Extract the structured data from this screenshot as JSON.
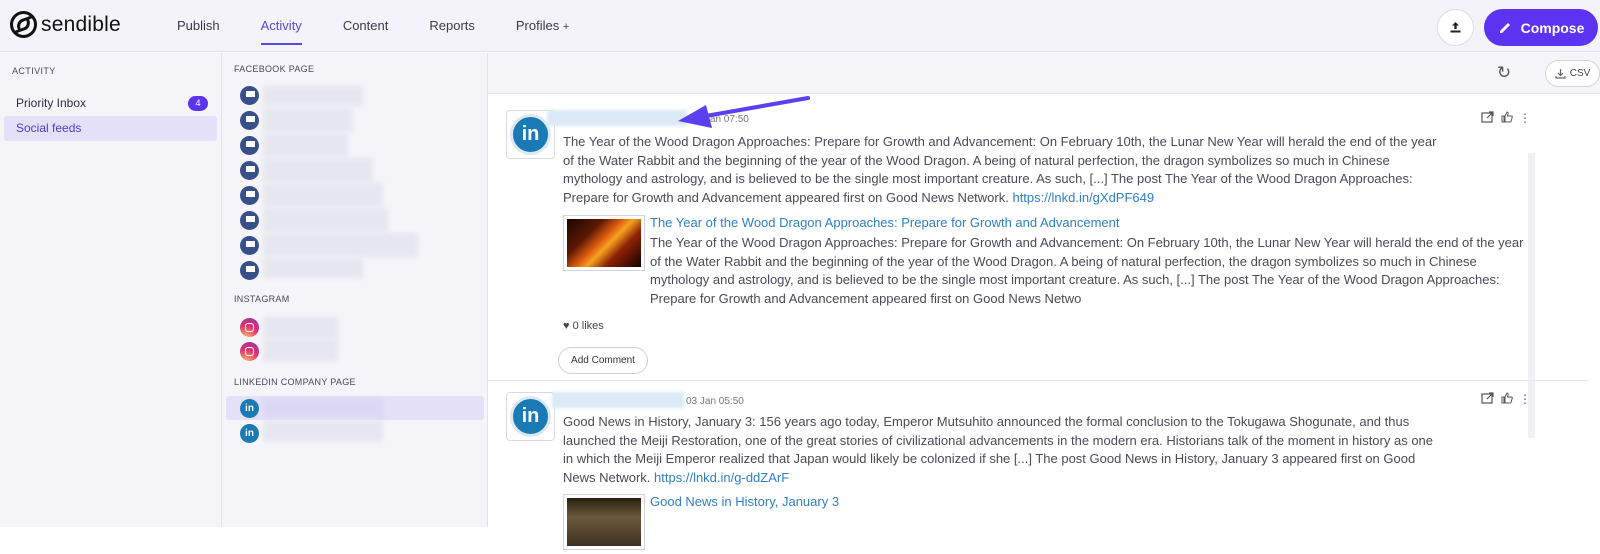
{
  "app": {
    "name": "sendible"
  },
  "nav": {
    "items": [
      {
        "label": "Publish"
      },
      {
        "label": "Activity"
      },
      {
        "label": "Content"
      },
      {
        "label": "Reports"
      },
      {
        "label": "Profiles",
        "suffix": "+"
      }
    ],
    "active": "Activity",
    "compose_label": "Compose"
  },
  "sidebar": {
    "heading": "ACTIVITY",
    "items": [
      {
        "label": "Priority Inbox",
        "badge": "4"
      },
      {
        "label": "Social feeds"
      }
    ]
  },
  "profiles": {
    "facebook_heading": "FACEBOOK PAGE",
    "instagram_heading": "INSTAGRAM",
    "linkedin_heading": "LINKEDIN COMPANY PAGE"
  },
  "toolbar": {
    "csv_label": "CSV"
  },
  "posts": [
    {
      "time": "03 Jan 07:50",
      "text": "The Year of the Wood Dragon Approaches: Prepare for Growth and Advancement: On February 10th, the Lunar New Year will herald the end of the year of the Water Rabbit and the beginning of the year of the Wood Dragon. A being of natural perfection, the dragon symbolizes so much in Chinese mythology and astrology, and is believed to be the single most important creature. As such, [...] The post The Year of the Wood Dragon Approaches: Prepare for Growth and Advancement appeared first on Good News Network.",
      "link": "https://lnkd.in/gXdPF649",
      "preview_title": "The Year of the Wood Dragon Approaches: Prepare for Growth and Advancement",
      "preview_text": "The Year of the Wood Dragon Approaches: Prepare for Growth and Advancement: On February 10th, the Lunar New Year will herald the end of the year of the Water Rabbit and the beginning of the year of the Wood Dragon. A being of natural perfection, the dragon symbolizes so much in Chinese mythology and astrology, and is believed to be the single most important creature. As such, [...] The post The Year of the Wood Dragon Approaches: Prepare for Growth and Advancement appeared first on Good News Netwo",
      "likes": "0 likes",
      "comment_label": "Add Comment"
    },
    {
      "time": "03 Jan 05:50",
      "text": "Good News in History, January 3: 156 years ago today, Emperor Mutsuhito announced the formal conclusion to the Tokugawa Shogunate, and thus launched the Meiji Restoration, one of the great stories of civilizational advancements in the modern era. Historians talk of the moment in history as one in which the Meiji Emperor realized that Japan would likely be colonized if she [...] The post Good News in History, January 3 appeared first on Good News Network.",
      "link": "https://lnkd.in/g-ddZArF",
      "preview_title": "Good News in History, January 3"
    }
  ]
}
